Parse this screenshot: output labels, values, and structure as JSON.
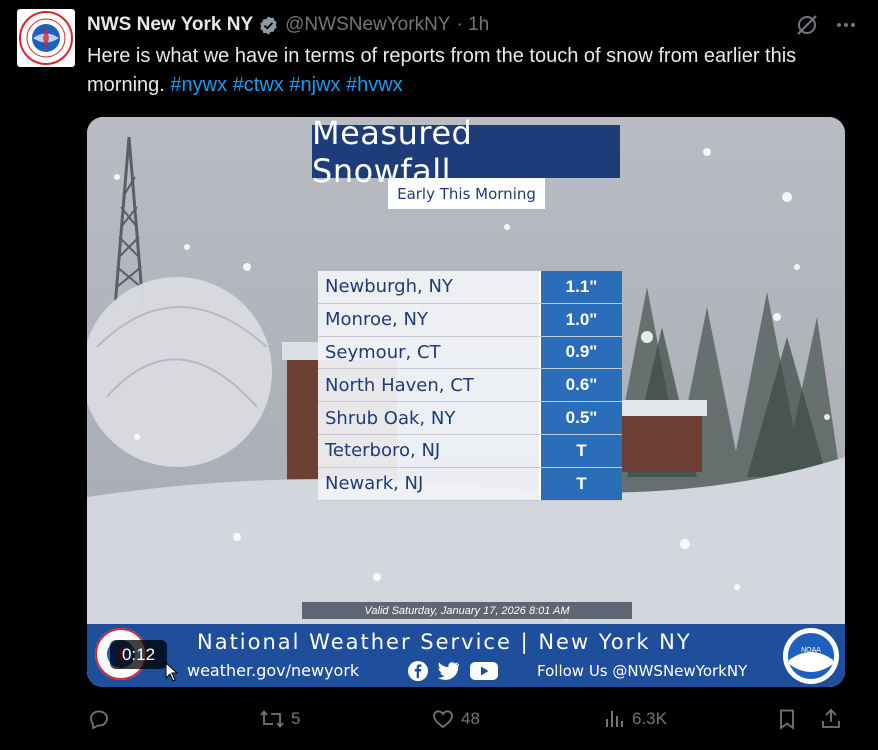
{
  "author": {
    "display_name": "NWS New York NY",
    "handle": "@NWSNewYorkNY",
    "time": "· 1h"
  },
  "tweet": {
    "text": "Here is what we have in terms of reports from the touch of snow from earlier this morning.",
    "hashtags": [
      "#nywx",
      "#ctwx",
      "#njwx",
      "#hvwx"
    ]
  },
  "graphic": {
    "title": "Measured Snowfall",
    "subtitle": "Early This Morning",
    "rows": [
      {
        "location": "Newburgh, NY",
        "amount": "1.1\""
      },
      {
        "location": "Monroe, NY",
        "amount": "1.0\""
      },
      {
        "location": "Seymour, CT",
        "amount": "0.9\""
      },
      {
        "location": "North Haven, CT",
        "amount": "0.6\""
      },
      {
        "location": "Shrub Oak, NY",
        "amount": "0.5\""
      },
      {
        "location": "Teterboro, NJ",
        "amount": "T"
      },
      {
        "location": "Newark, NJ",
        "amount": "T"
      }
    ],
    "valid_text": "Valid Saturday, January 17, 2026 8:01 AM",
    "footer_title": "National Weather Service | New York NY",
    "footer_url": "weather.gov/newyork",
    "footer_follow": "Follow Us @NWSNewYorkNY",
    "noaa_label": "NOAA"
  },
  "video": {
    "timer": "0:12"
  },
  "actions": {
    "reply_count": "",
    "retweet_count": "5",
    "like_count": "48",
    "views_count": "6.3K"
  },
  "colors": {
    "link": "#1d9bf0",
    "muted": "#71767b",
    "graphic_navy": "#1f3c7a",
    "graphic_blue": "#2a6db8"
  },
  "icons": [
    "nws-logo-icon",
    "verified-icon",
    "grok-icon",
    "more-icon",
    "reply-icon",
    "retweet-icon",
    "like-icon",
    "views-icon",
    "bookmark-icon",
    "share-icon",
    "facebook-icon",
    "twitter-icon",
    "youtube-icon",
    "noaa-logo-icon"
  ]
}
